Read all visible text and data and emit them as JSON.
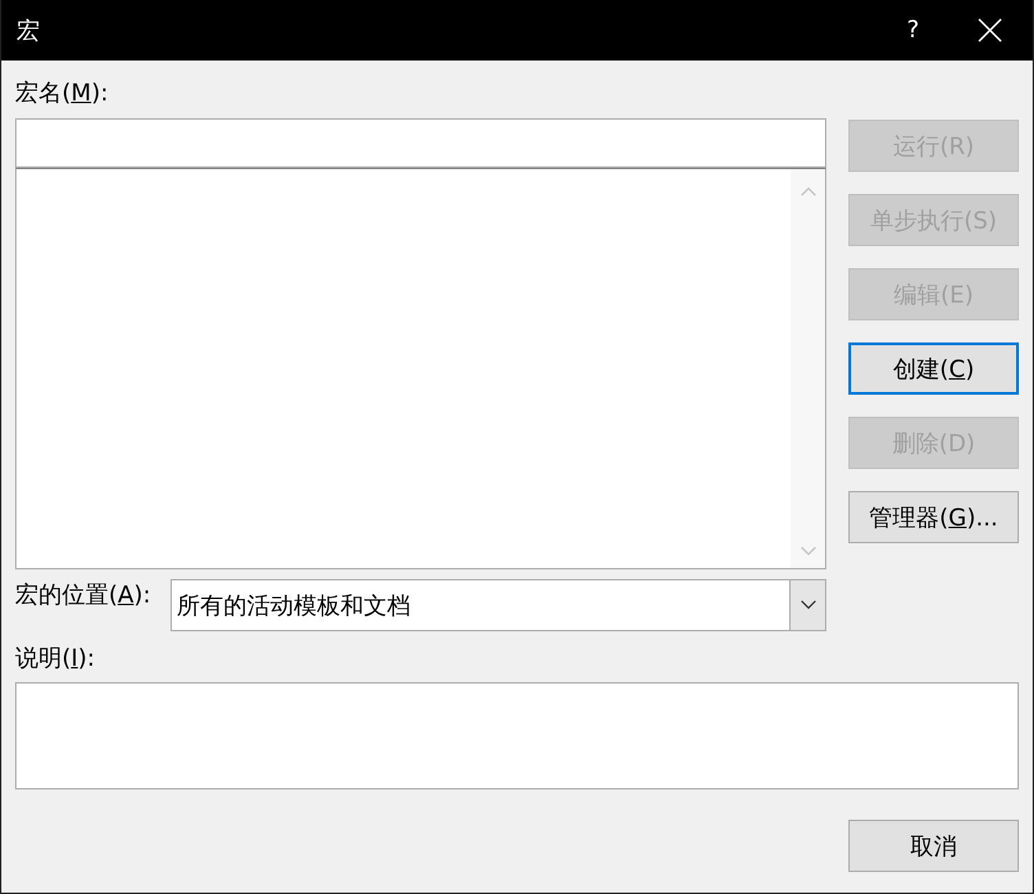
{
  "window": {
    "title": "宏",
    "help": "?"
  },
  "macro_name": {
    "label_parts": [
      "宏名(",
      "M",
      "):"
    ]
  },
  "location": {
    "label_parts": [
      "宏的位置(",
      "A",
      "):"
    ],
    "value": "所有的活动模板和文档"
  },
  "description": {
    "label_parts": [
      "说明(",
      "I",
      "):"
    ]
  },
  "buttons": [
    {
      "label": "运行(R)",
      "disabled": true,
      "focused": false
    },
    {
      "label": "单步执行(S)",
      "disabled": true,
      "focused": false
    },
    {
      "label": "编辑(E)",
      "disabled": true,
      "focused": false
    },
    {
      "label_parts": [
        "创建(",
        "C",
        ")"
      ],
      "disabled": false,
      "focused": true
    },
    {
      "label": "删除(D)",
      "disabled": true,
      "focused": false
    },
    {
      "label_parts": [
        "管理器(",
        "G",
        ")..."
      ],
      "disabled": false,
      "focused": false
    }
  ],
  "cancel_button": {
    "label": "取消"
  }
}
